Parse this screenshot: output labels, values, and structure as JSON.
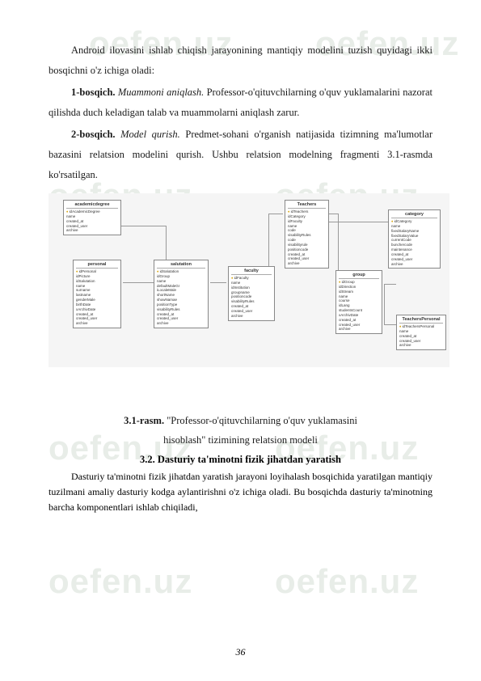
{
  "watermark": "oefen.uz",
  "para1": {
    "text": "Android ilovasini ishlab chiqish jarayonining mantiqiy modelini tuzish quyidagi ikki bosqichni o'z ichiga oladi:"
  },
  "para2": {
    "lead": "1-bosqich.",
    "title": "Muammoni aniqlash.",
    "text": "Professor-o'qituvchilarning o'quv yuklamalarini nazorat qilishda duch keladigan talab va muammolarni aniqlash zarur."
  },
  "para3": {
    "lead": "2-bosqich.",
    "title": "Model qurish.",
    "text": "Predmet-sohani o'rganish natijasida tizimning ma'lumotlar bazasini relatsion modelini qurish. Ushbu relatsion modelning fragmenti 3.1-rasmda ko'rsatilgan."
  },
  "diagram": {
    "boxes": {
      "academicdegree": {
        "title": "academicdegree",
        "items": [
          "idAcademicDegree",
          "name",
          "created_at",
          "created_user",
          "archive"
        ]
      },
      "personal": {
        "title": "personal",
        "items": [
          "idPersonal",
          "idPicture",
          "idSalutation",
          "name",
          "surname",
          "lastname",
          "genderMale",
          "birthDate",
          "xArchivDate",
          "created_at",
          "created_user",
          "archive"
        ]
      },
      "salutation": {
        "title": "salutation",
        "items": [
          "idSalutation",
          "idGroup",
          "name",
          "defaultMaleGr",
          "iLocaleMale",
          "shortName",
          "showNamae",
          "positionType",
          "visabilityRules",
          "created_at",
          "created_user",
          "archive"
        ]
      },
      "faculty": {
        "title": "faculty",
        "items": [
          "idFaculty",
          "name",
          "idInstitution",
          "groupname",
          "positioncode",
          "visabilityRules",
          "created_at",
          "created_user",
          "archive"
        ]
      },
      "teachers": {
        "title": "Teachers",
        "items": [
          "idTeachers",
          "idCategory",
          "idFaculty",
          "name",
          "code",
          "visabilityRules",
          "code",
          "visabilityrule",
          "positioncode",
          "created_at",
          "created_user",
          "archive"
        ]
      },
      "group": {
        "title": "group",
        "items": [
          "idGroup",
          "idDirection",
          "idStream",
          "name",
          "course",
          "idLang",
          "studentsCount",
          "xArchivDate",
          "created_at",
          "created_user",
          "archive"
        ]
      },
      "category": {
        "title": "category",
        "items": [
          "idCategory",
          "name",
          "fixedSalaryName",
          "fixedSalaryValue",
          "currentCode",
          "bunchercode",
          "maintenance",
          "created_at",
          "created_user",
          "archive"
        ]
      },
      "teacherspersonal": {
        "title": "TeachersPersonal",
        "items": [
          "idTeachersPersonal",
          "name",
          "created_at",
          "created_user",
          "archive"
        ]
      }
    }
  },
  "caption": {
    "line1_bold": "3.1-rasm.",
    "line1_text": " \"Professor-o'qituvchilarning o'quv yuklamasini",
    "line2": "hisoblash\" tizimining relatsion modeli"
  },
  "section_heading": "3.2. Dasturiy ta'minotni fizik jihatdan yaratish",
  "body": "Dasturiy ta'minotni fizik jihatdan yaratish jarayoni loyihalash bosqichida yaratilgan mantiqiy tuzilmani amaliy dasturiy kodga aylantirishni o'z ichiga oladi. Bu bosqichda dasturiy ta'minotning barcha komponentlari ishlab chiqiladi,",
  "page_number": "36"
}
